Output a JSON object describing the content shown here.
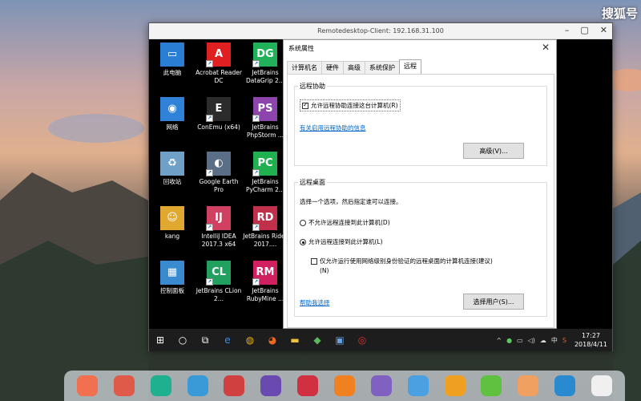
{
  "watermark": "搜狐号",
  "remote": {
    "title": "Remotedesktop-Client: 192.168.31.100",
    "desktop_icons": [
      {
        "label": "此电脑",
        "color": "#2a7fd4",
        "glyph": "▭"
      },
      {
        "label": "Acrobat Reader DC",
        "color": "#e02020",
        "glyph": "A"
      },
      {
        "label": "JetBrains DataGrip 2...",
        "color": "#21b15a",
        "glyph": "DG"
      },
      {
        "label": "网络",
        "color": "#2f82d8",
        "glyph": "◉"
      },
      {
        "label": "ConEmu (x64)",
        "color": "#2c2c2c",
        "glyph": "E"
      },
      {
        "label": "JetBrains PhpStorm ...",
        "color": "#8e44ad",
        "glyph": "PS"
      },
      {
        "label": "回收站",
        "color": "#6fa0c8",
        "glyph": "♻"
      },
      {
        "label": "Google Earth Pro",
        "color": "#5a6e86",
        "glyph": "◐"
      },
      {
        "label": "JetBrains PyCharm 2...",
        "color": "#20b050",
        "glyph": "PC"
      },
      {
        "label": "kang",
        "color": "#e0a830",
        "glyph": "☺"
      },
      {
        "label": "IntelliJ IDEA 2017.3 x64",
        "color": "#d04060",
        "glyph": "IJ"
      },
      {
        "label": "JetBrains Rider 2017....",
        "color": "#c0304a",
        "glyph": "RD"
      },
      {
        "label": "控制面板",
        "color": "#3a8ad0",
        "glyph": "▦"
      },
      {
        "label": "JetBrains CLion 2...",
        "color": "#21a060",
        "glyph": "CL"
      },
      {
        "label": "JetBrains RubyMine ...",
        "color": "#d02060",
        "glyph": "RM"
      }
    ],
    "dialog": {
      "title": "系统属性",
      "tabs": [
        "计算机名",
        "硬件",
        "高级",
        "系统保护",
        "远程"
      ],
      "assist_group": "远程协助",
      "assist_checkbox": "允许远程协助连接这台计算机(R)",
      "assist_link": "有关启用远程协助的信息",
      "advanced_btn": "高级(V)...",
      "desktop_group": "远程桌面",
      "desktop_prompt": "选择一个选项，然后指定谁可以连接。",
      "radio_deny": "不允许远程连接到此计算机(D)",
      "radio_allow": "允许远程连接到此计算机(L)",
      "nla_checkbox": "仅允许运行使用网络级别身份验证的远程桌面的计算机连接(建议)",
      "nla_checkbox_key": "(N)",
      "help_link": "帮助我选择",
      "select_users_btn": "选择用户(S)...",
      "assist_checked": true,
      "allow_selected": true,
      "nla_checked": false
    },
    "taskbar": {
      "tray_ime": "中",
      "time": "17:27",
      "date": "2018/4/11"
    }
  },
  "dock_colors": [
    "#f07050",
    "#e05a4a",
    "#1fb090",
    "#3a9ad8",
    "#d04040",
    "#6a4ab0",
    "#d03040",
    "#f08020",
    "#8060c0",
    "#4aa0e0",
    "#f0a020",
    "#60c040",
    "#f0a060",
    "#2a8ad0",
    "#f0f0f0"
  ]
}
